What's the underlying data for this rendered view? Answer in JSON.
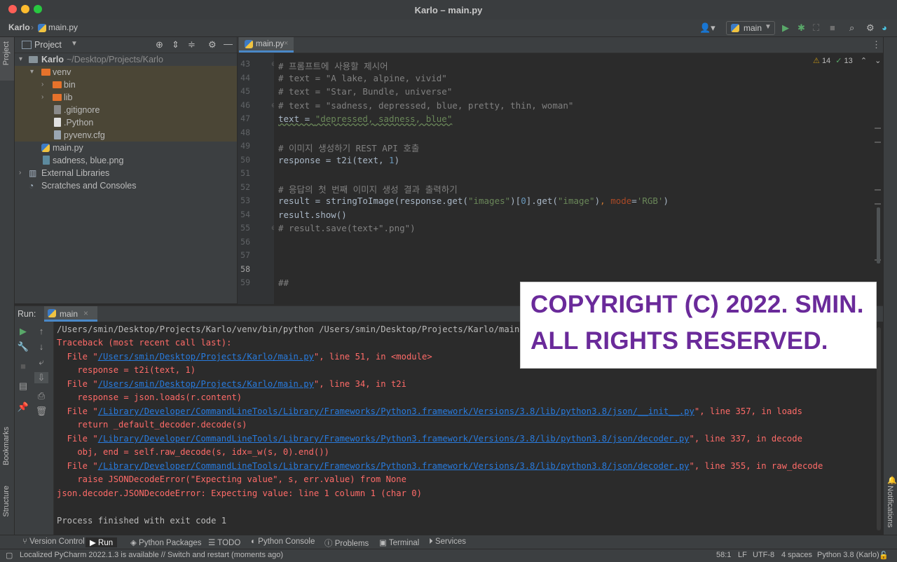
{
  "window": {
    "title": "Karlo – main.py"
  },
  "navbar": {
    "project": "Karlo",
    "file": "main.py",
    "run_config": "main"
  },
  "left_strip": {
    "project": "Project",
    "bookmarks": "Bookmarks",
    "structure": "Structure"
  },
  "right_strip": {
    "notifications": "Notifications"
  },
  "project_panel": {
    "title": "Project",
    "root": {
      "name": "Karlo",
      "path": "~/Desktop/Projects/Karlo"
    },
    "items": [
      "venv",
      "bin",
      "lib",
      ".gitignore",
      ".Python",
      "pyvenv.cfg",
      "main.py",
      "sadness, blue.png",
      "External Libraries",
      "Scratches and Consoles"
    ]
  },
  "editor": {
    "tab": "main.py",
    "inspections": {
      "warnings": "14",
      "weak_warnings": "13"
    },
    "line_numbers": [
      "43",
      "44",
      "45",
      "46",
      "47",
      "48",
      "49",
      "50",
      "51",
      "52",
      "53",
      "54",
      "55",
      "56",
      "57",
      "58",
      "59"
    ],
    "code": {
      "l43": "# 프롬프트에 사용할 제시어",
      "l44": "# text = \"A lake, alpine, vivid\"",
      "l45": "# text = \"Star, Bundle, universe\"",
      "l46": "# text = \"sadness, depressed, blue, pretty, thin, woman\"",
      "l47_a": "text = ",
      "l47_b": "\"depressed, sadness, blue\"",
      "l49": "# 이미지 생성하기 REST API 호출",
      "l50_a": "response = t2i(text, ",
      "l50_b": "1",
      "l50_c": ")",
      "l52": "# 응답의 첫 번째 이미지 생성 결과 출력하기",
      "l53_a": "result = stringToImage(response.get(",
      "l53_b": "\"images\"",
      "l53_c": ")[",
      "l53_d": "0",
      "l53_e": "].get(",
      "l53_f": "\"image\"",
      "l53_g": ")",
      "l53_h": ", ",
      "l53_i": "mode",
      "l53_j": "=",
      "l53_k": "'RGB'",
      "l53_l": ")",
      "l54": "result.show()",
      "l55": "# result.save(text+\".png\")",
      "l59": "##"
    }
  },
  "run_panel": {
    "label": "Run:",
    "config": "main",
    "console": {
      "c1": "/Users/smin/Desktop/Projects/Karlo/venv/bin/python /Users/smin/Desktop/Projects/Karlo/main.py",
      "c2": "Traceback (most recent call last):",
      "c3_a": "  File \"",
      "c3_b": "/Users/smin/Desktop/Projects/Karlo/main.py",
      "c3_c": "\", line 51, in <module>",
      "c4": "    response = t2i(text, 1)",
      "c5_a": "  File \"",
      "c5_b": "/Users/smin/Desktop/Projects/Karlo/main.py",
      "c5_c": "\", line 34, in t2i",
      "c6": "    response = json.loads(r.content)",
      "c7_a": "  File \"",
      "c7_b": "/Library/Developer/CommandLineTools/Library/Frameworks/Python3.framework/Versions/3.8/lib/python3.8/json/__init__.py",
      "c7_c": "\", line 357, in loads",
      "c8": "    return _default_decoder.decode(s)",
      "c9_a": "  File \"",
      "c9_b": "/Library/Developer/CommandLineTools/Library/Frameworks/Python3.framework/Versions/3.8/lib/python3.8/json/decoder.py",
      "c9_c": "\", line 337, in decode",
      "c10": "    obj, end = self.raw_decode(s, idx=_w(s, 0).end())",
      "c11_a": "  File \"",
      "c11_b": "/Library/Developer/CommandLineTools/Library/Frameworks/Python3.framework/Versions/3.8/lib/python3.8/json/decoder.py",
      "c11_c": "\", line 355, in raw_decode",
      "c12": "    raise JSONDecodeError(\"Expecting value\", s, err.value) from None",
      "c13": "json.decoder.JSONDecodeError: Expecting value: line 1 column 1 (char 0)",
      "c15": "Process finished with exit code 1"
    }
  },
  "watermark": {
    "line1": "COPYRIGHT (C) 2022. SMIN.",
    "line2": "ALL RIGHTS RESERVED."
  },
  "bottom_tabs": [
    "Version Control",
    "Run",
    "Python Packages",
    "TODO",
    "Python Console",
    "Problems",
    "Terminal",
    "Services"
  ],
  "status_bar": {
    "message": "Localized PyCharm 2022.1.3 is available // Switch and restart (moments ago)",
    "position": "58:1",
    "line_sep": "LF",
    "encoding": "UTF-8",
    "indent": "4 spaces",
    "interpreter": "Python 3.8 (Karlo)"
  },
  "colors": {
    "accent": "#4a88c7",
    "error": "#ff6b68",
    "link": "#287bde",
    "watermark": "#6a2a9a"
  }
}
